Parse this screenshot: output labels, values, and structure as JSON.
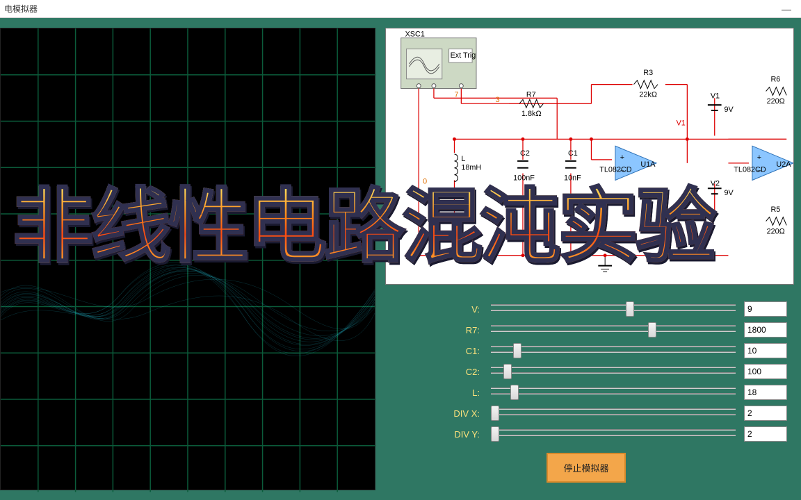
{
  "window": {
    "title": "电模拟器"
  },
  "overlay": {
    "headline": "非线性电路混沌实验"
  },
  "schematic": {
    "scope_name": "XSC1",
    "scope_ext": "Ext Trig",
    "net_labels": {
      "n7": "7",
      "n3": "3",
      "n0": "0"
    },
    "components": {
      "L": {
        "name": "L",
        "value": "18mH"
      },
      "C2": {
        "name": "C2",
        "value": "100nF"
      },
      "C1": {
        "name": "C1",
        "value": "10nF"
      },
      "R7": {
        "name": "R7",
        "value": "1.8kΩ"
      },
      "R3": {
        "name": "R3",
        "value": "22kΩ"
      },
      "R6": {
        "name": "R6",
        "value": "220Ω"
      },
      "R5": {
        "name": "R5",
        "value": "220Ω"
      },
      "V1": {
        "name": "V1",
        "value": "9V"
      },
      "V2": {
        "name": "V2",
        "value": "9V"
      },
      "U1A": {
        "name": "U1A",
        "part": "TL082CD"
      },
      "U2A": {
        "name": "U2A",
        "part": "TL082CD"
      },
      "net_v1": "V1"
    }
  },
  "controls": {
    "items": [
      {
        "label": "V:",
        "value": "9",
        "thumb_pct": 55
      },
      {
        "label": "R7:",
        "value": "1800",
        "thumb_pct": 64
      },
      {
        "label": "C1:",
        "value": "10",
        "thumb_pct": 10
      },
      {
        "label": "C2:",
        "value": "100",
        "thumb_pct": 6
      },
      {
        "label": "L:",
        "value": "18",
        "thumb_pct": 9
      },
      {
        "label": "DIV X:",
        "value": "2",
        "thumb_pct": 1
      },
      {
        "label": "DIV Y:",
        "value": "2",
        "thumb_pct": 1
      }
    ]
  },
  "buttons": {
    "stop": "停止模拟器"
  },
  "colors": {
    "panel": "#2f7763",
    "accent_label": "#fde27c",
    "stop_btn": "#f3a64a"
  }
}
